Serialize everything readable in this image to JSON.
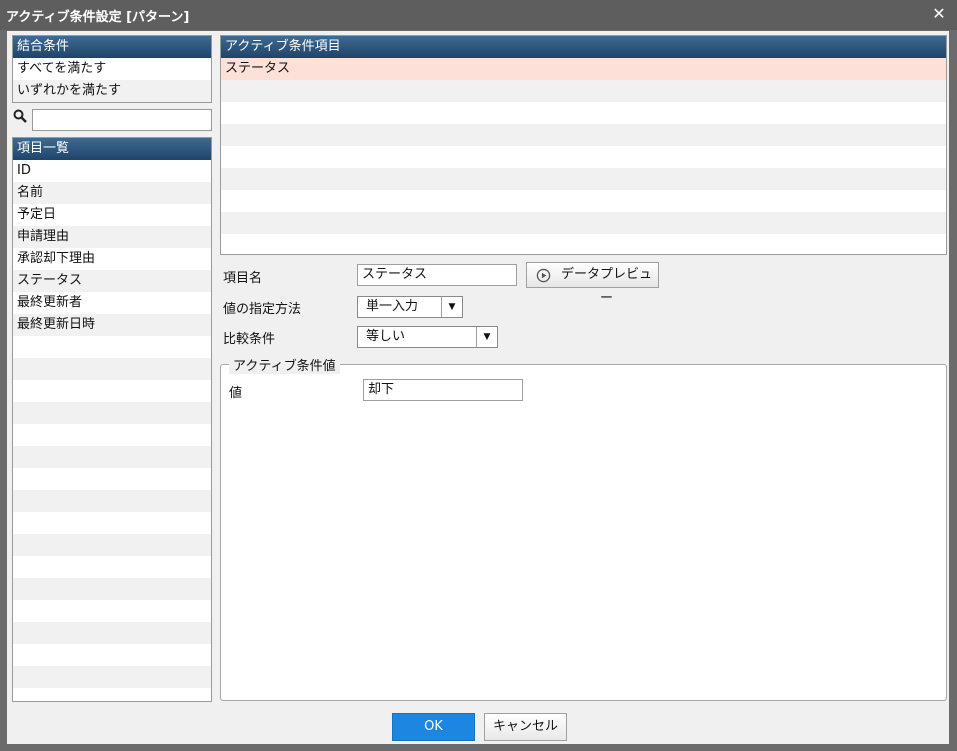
{
  "window": {
    "title": "アクティブ条件設定 [パターン]"
  },
  "join_conditions": {
    "header": "結合条件",
    "items": [
      "すべてを満たす",
      "いずれかを満たす"
    ]
  },
  "search": {
    "value": ""
  },
  "item_list": {
    "header": "項目一覧",
    "items": [
      "ID",
      "名前",
      "予定日",
      "申請理由",
      "承認却下理由",
      "ステータス",
      "最終更新者",
      "最終更新日時"
    ]
  },
  "active_items": {
    "header": "アクティブ条件項目",
    "items": [
      "ステータス"
    ]
  },
  "form": {
    "item_name_label": "項目名",
    "item_name_value": "ステータス",
    "preview_button": "データプレビュー",
    "method_label": "値の指定方法",
    "method_value": "単一入力",
    "compare_label": "比較条件",
    "compare_value": "等しい",
    "value_group_title": "アクティブ条件値",
    "value_label": "値",
    "value_value": "却下"
  },
  "footer": {
    "ok_label": "OK",
    "cancel_label": "キャンセル"
  },
  "colors": {
    "header": "#1f4469",
    "selected_row": "#fde0d7",
    "ok": "#1d86e0"
  }
}
